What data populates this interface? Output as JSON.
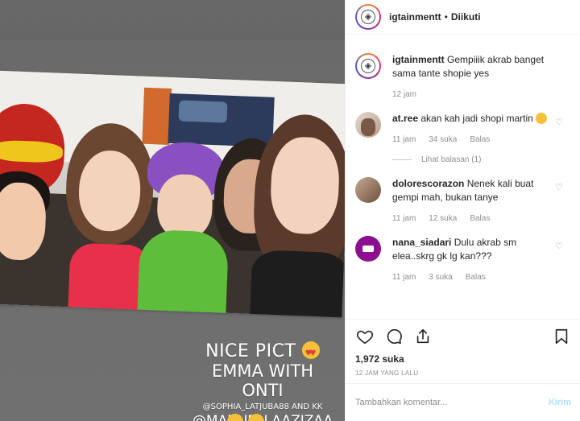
{
  "story": {
    "line1": "NICE PICT",
    "line2": "EMMA WITH ONTI",
    "line3": "@SOPHIA_LATJUBA88 AND KK",
    "line4": "@MANUELLAAZIZAA"
  },
  "header": {
    "username": "igtainmentt",
    "separator": "•",
    "follow_status": "Diikuti"
  },
  "caption": {
    "username": "igtainmentt",
    "text": "Gempiiik akrab banget sama tante shopie yes",
    "time": "12 jam"
  },
  "comments": [
    {
      "username": "at.ree",
      "text": "akan kah jadi shopi martin",
      "time": "11 jam",
      "likes": "34 suka",
      "reply": "Balas"
    },
    {
      "username": "dolorescorazon",
      "text": "Nenek kali buat gempi mah, bukan tanye",
      "time": "11 jam",
      "likes": "12 suka",
      "reply": "Balas"
    },
    {
      "username": "nana_siadari",
      "text": "Dulu akrab sm elea..skrg gk lg kan???",
      "time": "11 jam",
      "likes": "3 suka",
      "reply": "Balas"
    }
  ],
  "view_replies": "Lihat balasan (1)",
  "post": {
    "likes": "1,972 suka",
    "time_ago": "12 JAM YANG LALU"
  },
  "add_comment": {
    "placeholder": "Tambahkan komentar...",
    "send_label": "Kirim"
  },
  "colors": {
    "text": "#262626",
    "muted": "#8e8e8e",
    "send_disabled": "#b2dffc",
    "divider": "#efefef"
  },
  "icons": [
    "heart-icon",
    "comment-icon",
    "share-icon",
    "bookmark-icon",
    "like-comment-heart-icon"
  ]
}
